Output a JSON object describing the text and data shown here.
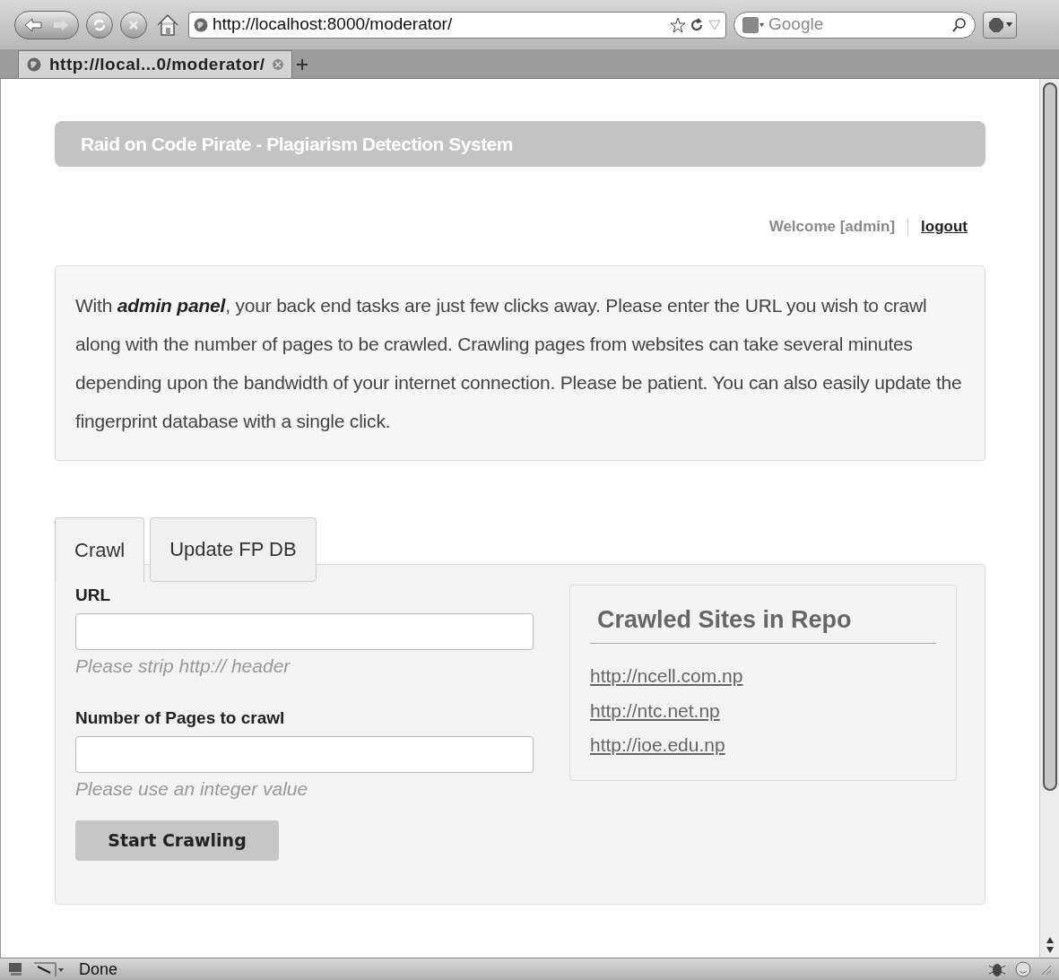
{
  "browser": {
    "url": "http://localhost:8000/moderator/",
    "search": {
      "placeholder": "Google"
    },
    "tabs": [
      {
        "label": "http://local...0/moderator/",
        "selected": true
      }
    ],
    "status": "Done"
  },
  "page": {
    "title": "Raid on Code Pirate - Plagiarism Detection System",
    "welcome": "Welcome [admin]",
    "logout": "logout",
    "intro": "With **admin panel**, your back end tasks are just few clicks away. Please enter the URL you wish to crawl along with the number of pages to be crawled. Crawling pages from websites can take several minutes depending upon the bandwidth of your internet connection. Please be patient. You can also easily update the fingerprint database with a single click.",
    "tabs": [
      {
        "label": "Crawl",
        "selected": true
      },
      {
        "label": "Update FP DB",
        "selected": false
      }
    ],
    "fields": [
      {
        "label": "URL",
        "help": "Please strip http:// header"
      },
      {
        "label": "Number of Pages to crawl",
        "help": "Please use an integer value"
      }
    ],
    "button": "Start Crawling",
    "repo": {
      "title": "Crawled Sites in Repo",
      "links": [
        "http://ncell.com.np",
        "http://ntc.net.np",
        "http://ioe.edu.np"
      ]
    }
  }
}
